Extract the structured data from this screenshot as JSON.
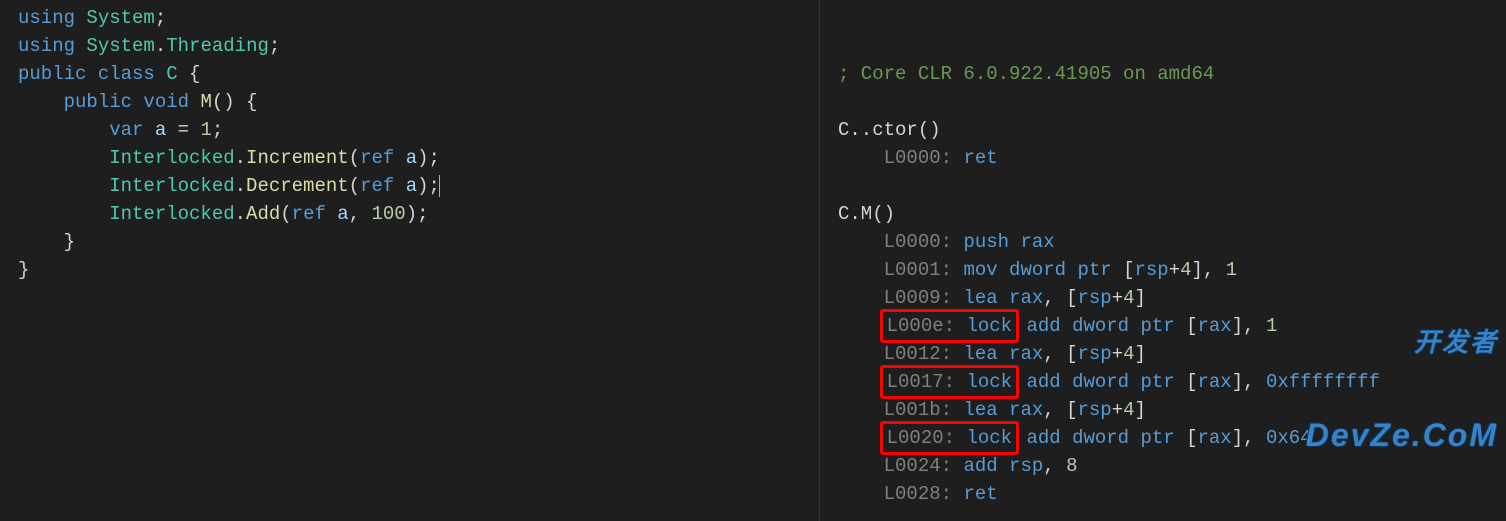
{
  "left": {
    "lines": [
      [
        {
          "t": "using ",
          "c": "kw"
        },
        {
          "t": "System",
          "c": "cls"
        },
        {
          "t": ";",
          "c": "punct"
        }
      ],
      [
        {
          "t": "using ",
          "c": "kw"
        },
        {
          "t": "System",
          "c": "cls"
        },
        {
          "t": ".",
          "c": "punct"
        },
        {
          "t": "Threading",
          "c": "cls"
        },
        {
          "t": ";",
          "c": "punct"
        }
      ],
      [
        {
          "t": "public class ",
          "c": "kw"
        },
        {
          "t": "C ",
          "c": "cls"
        },
        {
          "t": "{",
          "c": "punct"
        }
      ],
      [
        {
          "t": "    ",
          "c": "plain"
        },
        {
          "t": "public void ",
          "c": "kw"
        },
        {
          "t": "M",
          "c": "fn"
        },
        {
          "t": "() {",
          "c": "punct"
        }
      ],
      [
        {
          "t": "        ",
          "c": "plain"
        },
        {
          "t": "var ",
          "c": "kw"
        },
        {
          "t": "a ",
          "c": "param"
        },
        {
          "t": "= ",
          "c": "punct"
        },
        {
          "t": "1",
          "c": "num"
        },
        {
          "t": ";",
          "c": "punct"
        }
      ],
      [
        {
          "t": "        ",
          "c": "plain"
        },
        {
          "t": "Interlocked",
          "c": "cls"
        },
        {
          "t": ".",
          "c": "punct"
        },
        {
          "t": "Increment",
          "c": "fn"
        },
        {
          "t": "(",
          "c": "punct"
        },
        {
          "t": "ref ",
          "c": "kw"
        },
        {
          "t": "a",
          "c": "param"
        },
        {
          "t": ");",
          "c": "punct"
        }
      ],
      [
        {
          "t": "        ",
          "c": "plain"
        },
        {
          "t": "Interlocked",
          "c": "cls"
        },
        {
          "t": ".",
          "c": "punct"
        },
        {
          "t": "Decrement",
          "c": "fn"
        },
        {
          "t": "(",
          "c": "punct"
        },
        {
          "t": "ref ",
          "c": "kw"
        },
        {
          "t": "a",
          "c": "param"
        },
        {
          "t": ");",
          "c": "punct"
        },
        {
          "t": "",
          "c": "cursor"
        }
      ],
      [
        {
          "t": "        ",
          "c": "plain"
        },
        {
          "t": "Interlocked",
          "c": "cls"
        },
        {
          "t": ".",
          "c": "punct"
        },
        {
          "t": "Add",
          "c": "fn"
        },
        {
          "t": "(",
          "c": "punct"
        },
        {
          "t": "ref ",
          "c": "kw"
        },
        {
          "t": "a",
          "c": "param"
        },
        {
          "t": ", ",
          "c": "punct"
        },
        {
          "t": "100",
          "c": "num"
        },
        {
          "t": ");",
          "c": "punct"
        }
      ],
      [
        {
          "t": "    }",
          "c": "punct"
        }
      ],
      [
        {
          "t": "}",
          "c": "punct"
        }
      ]
    ]
  },
  "right": {
    "lines": [
      [
        {
          "t": "; Core CLR 6.0.922.41905 on amd64",
          "c": "comment"
        }
      ],
      [],
      [
        {
          "t": "C..ctor()",
          "c": "plain"
        }
      ],
      [
        {
          "t": "    ",
          "c": "plain"
        },
        {
          "t": "L0000: ",
          "c": "label"
        },
        {
          "t": "ret",
          "c": "instr"
        }
      ],
      [],
      [
        {
          "t": "C.M()",
          "c": "plain"
        }
      ],
      [
        {
          "t": "    ",
          "c": "plain"
        },
        {
          "t": "L0000: ",
          "c": "label"
        },
        {
          "t": "push ",
          "c": "instr"
        },
        {
          "t": "rax",
          "c": "reg"
        }
      ],
      [
        {
          "t": "    ",
          "c": "plain"
        },
        {
          "t": "L0001: ",
          "c": "label"
        },
        {
          "t": "mov ",
          "c": "instr"
        },
        {
          "t": "dword ptr ",
          "c": "reg"
        },
        {
          "t": "[",
          "c": "br"
        },
        {
          "t": "rsp",
          "c": "reg"
        },
        {
          "t": "+",
          "c": "punct"
        },
        {
          "t": "4",
          "c": "num"
        },
        {
          "t": "], ",
          "c": "br"
        },
        {
          "t": "1",
          "c": "num"
        }
      ],
      [
        {
          "t": "    ",
          "c": "plain"
        },
        {
          "t": "L0009: ",
          "c": "label"
        },
        {
          "t": "lea ",
          "c": "instr"
        },
        {
          "t": "rax",
          "c": "reg"
        },
        {
          "t": ", [",
          "c": "br"
        },
        {
          "t": "rsp",
          "c": "reg"
        },
        {
          "t": "+",
          "c": "punct"
        },
        {
          "t": "4",
          "c": "num"
        },
        {
          "t": "]",
          "c": "br"
        }
      ],
      [
        {
          "t": "    ",
          "c": "plain"
        },
        {
          "t": "L000e: ",
          "c": "label",
          "hl": "start"
        },
        {
          "t": "lock",
          "c": "instr",
          "hl": "end"
        },
        {
          "t": " add ",
          "c": "instr"
        },
        {
          "t": "dword ptr ",
          "c": "reg"
        },
        {
          "t": "[",
          "c": "br"
        },
        {
          "t": "rax",
          "c": "reg"
        },
        {
          "t": "], ",
          "c": "br"
        },
        {
          "t": "1",
          "c": "num"
        }
      ],
      [
        {
          "t": "    ",
          "c": "plain"
        },
        {
          "t": "L0012: ",
          "c": "label"
        },
        {
          "t": "lea ",
          "c": "instr"
        },
        {
          "t": "rax",
          "c": "reg"
        },
        {
          "t": ", [",
          "c": "br"
        },
        {
          "t": "rsp",
          "c": "reg"
        },
        {
          "t": "+",
          "c": "punct"
        },
        {
          "t": "4",
          "c": "num"
        },
        {
          "t": "]",
          "c": "br"
        }
      ],
      [
        {
          "t": "    ",
          "c": "plain"
        },
        {
          "t": "L0017: ",
          "c": "label",
          "hl": "start"
        },
        {
          "t": "lock",
          "c": "instr",
          "hl": "end"
        },
        {
          "t": " add ",
          "c": "instr"
        },
        {
          "t": "dword ptr ",
          "c": "reg"
        },
        {
          "t": "[",
          "c": "br"
        },
        {
          "t": "rax",
          "c": "reg"
        },
        {
          "t": "], ",
          "c": "br"
        },
        {
          "t": "0xffffffff",
          "c": "hexval"
        }
      ],
      [
        {
          "t": "    ",
          "c": "plain"
        },
        {
          "t": "L001b: ",
          "c": "label"
        },
        {
          "t": "lea ",
          "c": "instr"
        },
        {
          "t": "rax",
          "c": "reg"
        },
        {
          "t": ", [",
          "c": "br"
        },
        {
          "t": "rsp",
          "c": "reg"
        },
        {
          "t": "+",
          "c": "punct"
        },
        {
          "t": "4",
          "c": "num"
        },
        {
          "t": "]",
          "c": "br"
        }
      ],
      [
        {
          "t": "    ",
          "c": "plain"
        },
        {
          "t": "L0020: ",
          "c": "label",
          "hl": "start"
        },
        {
          "t": "lock",
          "c": "instr",
          "hl": "end"
        },
        {
          "t": " add ",
          "c": "instr"
        },
        {
          "t": "dword ptr ",
          "c": "reg"
        },
        {
          "t": "[",
          "c": "br"
        },
        {
          "t": "rax",
          "c": "reg"
        },
        {
          "t": "], ",
          "c": "br"
        },
        {
          "t": "0x64",
          "c": "hexval"
        }
      ],
      [
        {
          "t": "    ",
          "c": "plain"
        },
        {
          "t": "L0024: ",
          "c": "label"
        },
        {
          "t": "add ",
          "c": "instr"
        },
        {
          "t": "rsp",
          "c": "reg"
        },
        {
          "t": ", ",
          "c": "br"
        },
        {
          "t": "8",
          "c": "num"
        }
      ],
      [
        {
          "t": "    ",
          "c": "plain"
        },
        {
          "t": "L0028: ",
          "c": "label"
        },
        {
          "t": "ret",
          "c": "instr"
        }
      ]
    ]
  },
  "watermark": {
    "top": "开发者",
    "bot": "DevZe.CoM"
  }
}
